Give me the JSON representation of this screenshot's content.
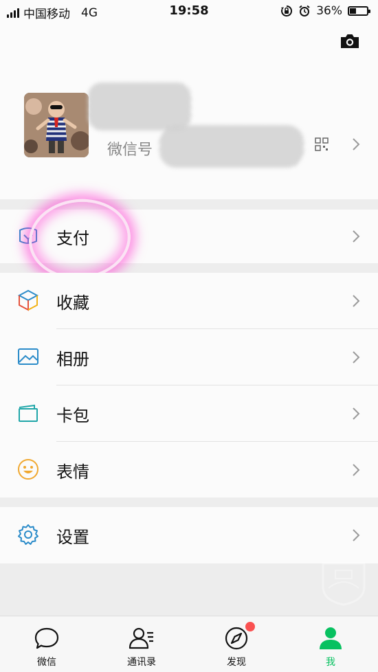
{
  "status_bar": {
    "carrier": "中国移动",
    "network": "4G",
    "time": "19:58",
    "battery_percent": "36%",
    "battery_level": 0.36,
    "icons": [
      "signal-icon",
      "rotation-lock-icon",
      "alarm-icon",
      "battery-icon"
    ]
  },
  "profile": {
    "camera_icon": "camera-icon",
    "wechat_id_label": "微信号",
    "qr_icon": "qr-code-icon"
  },
  "menu": {
    "pay": {
      "label": "支付",
      "icon": "wallet-icon",
      "color": "#2a8bc9"
    },
    "favorites": {
      "label": "收藏",
      "icon": "cube-icon"
    },
    "album": {
      "label": "相册",
      "icon": "image-icon",
      "color": "#2a8bc9"
    },
    "cards": {
      "label": "卡包",
      "icon": "card-icon",
      "color": "#1fa6a8"
    },
    "stickers": {
      "label": "表情",
      "icon": "smiley-icon",
      "color": "#f0a830"
    },
    "settings": {
      "label": "设置",
      "icon": "gear-icon",
      "color": "#2a8bc9"
    }
  },
  "tab_bar": {
    "tabs": [
      {
        "label": "微信",
        "icon": "chat-bubble-icon"
      },
      {
        "label": "通讯录",
        "icon": "contacts-icon"
      },
      {
        "label": "发现",
        "icon": "compass-icon"
      },
      {
        "label": "我",
        "icon": "person-icon",
        "active": true
      }
    ],
    "active_color": "#07c160"
  }
}
